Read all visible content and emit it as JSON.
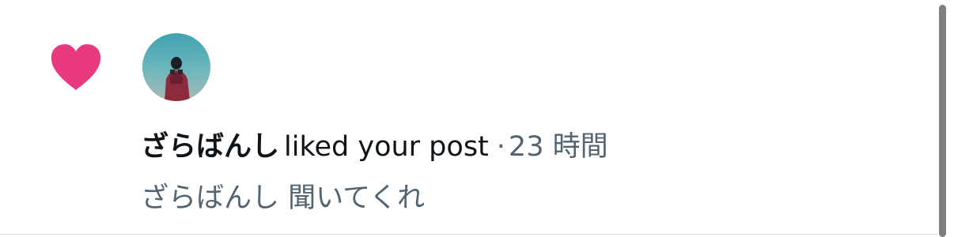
{
  "notification": {
    "icon": "heart-icon",
    "icon_color": "#e8397f",
    "user": "ざらばんし",
    "action": "liked your post",
    "separator": "·",
    "timestamp": "23 時間",
    "preview": "ざらばんし 聞いてくれ"
  },
  "colors": {
    "primary_text": "#0f1419",
    "secondary_text": "#536471",
    "divider": "#d9dde0"
  }
}
